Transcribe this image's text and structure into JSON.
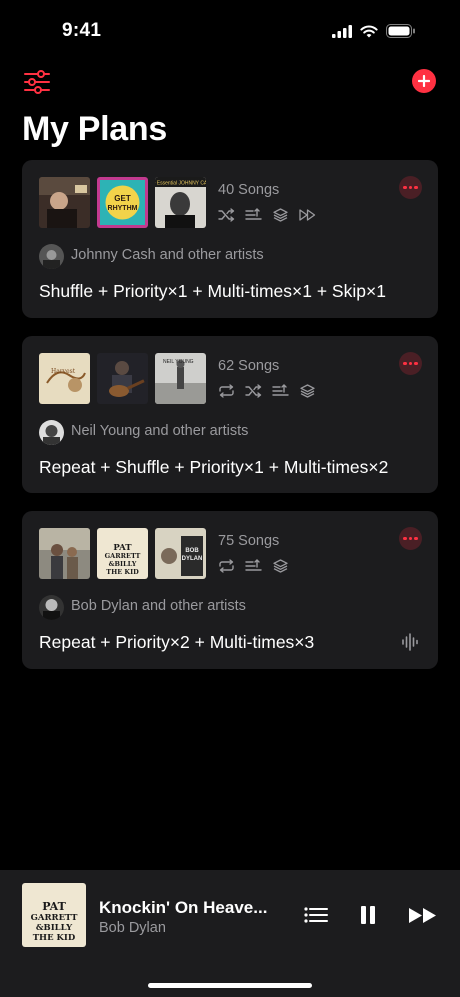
{
  "status_bar": {
    "time": "9:41"
  },
  "header": {
    "title": "My Plans"
  },
  "plans": [
    {
      "songs": "40 Songs",
      "artists": "Johnny Cash and other artists",
      "rule": "Shuffle + Priority×1 + Multi-times×1 + Skip×1",
      "modes": [
        "shuffle-icon",
        "priority-icon",
        "multi-times-icon",
        "skip-icon"
      ],
      "album_texts": [
        "GET RHYTHM",
        "The Essential JOHNNY CASH"
      ]
    },
    {
      "songs": "62 Songs",
      "artists": "Neil Young and other artists",
      "rule": "Repeat + Shuffle + Priority×1 + Multi-times×2",
      "modes": [
        "repeat-icon",
        "shuffle-icon",
        "priority-icon",
        "multi-times-icon"
      ],
      "album_texts": [
        "FREEDOM",
        "NEIL YOUNG"
      ]
    },
    {
      "songs": "75 Songs",
      "artists": "Bob Dylan and other artists",
      "rule": "Repeat + Priority×2 + Multi-times×3",
      "modes": [
        "repeat-icon",
        "priority-icon",
        "multi-times-icon"
      ],
      "album_texts": [
        "PAT GARRETT & BILLY THE KID",
        "BOB DYLAN"
      ]
    }
  ],
  "now_playing": {
    "title": "Knockin' On Heave...",
    "artist": "Bob Dylan",
    "cover_text": "PAT GARRETT & BILLY THE KID"
  },
  "colors": {
    "accent": "#ff3142",
    "card": "#1c1c1e",
    "secondary_text": "#9a9a9e"
  }
}
